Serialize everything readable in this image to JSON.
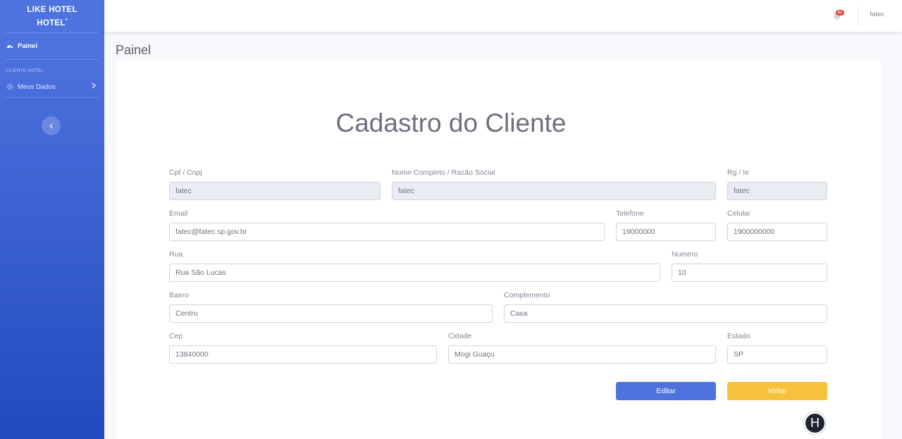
{
  "sidebar": {
    "brand_line1": "LIKE HOTEL",
    "brand_line2": "HOTEL",
    "brand_sup": "*",
    "dashboard_label": "Painel",
    "section_heading": "CLIENTE HOTEL",
    "meus_dados_label": "Meus Dados"
  },
  "topbar": {
    "alert_count": "3+",
    "user_name": "fatec"
  },
  "page": {
    "title": "Painel",
    "form_title": "Cadastro do Cliente"
  },
  "form": {
    "cpf": {
      "label": "Cpf / Cnpj",
      "value": "fatec"
    },
    "nome": {
      "label": "Nome Completo / Razão Social",
      "value": "fatec"
    },
    "rg": {
      "label": "Rg / Ie",
      "value": "fatec"
    },
    "email": {
      "label": "Email",
      "value": "fatec@fatec.sp.gov.br"
    },
    "telefone": {
      "label": "Telefone",
      "value": "19000000"
    },
    "celular": {
      "label": "Celular",
      "value": "1900000000"
    },
    "rua": {
      "label": "Rua",
      "value": "Rua São Lucas"
    },
    "numero": {
      "label": "Numero",
      "value": "10"
    },
    "bairro": {
      "label": "Bairro",
      "value": "Centro"
    },
    "complemento": {
      "label": "Complemento",
      "value": "Casa"
    },
    "cep": {
      "label": "Cep",
      "value": "13840000"
    },
    "cidade": {
      "label": "Cidade",
      "value": "Mogi Guaçu"
    },
    "estado": {
      "label": "Estado",
      "value": "SP"
    }
  },
  "buttons": {
    "edit_label": "Editar",
    "back_label": "Voltar"
  },
  "fab": {
    "letter": "H"
  },
  "colors": {
    "primary": "#4e73df",
    "warning": "#f6c23e"
  }
}
